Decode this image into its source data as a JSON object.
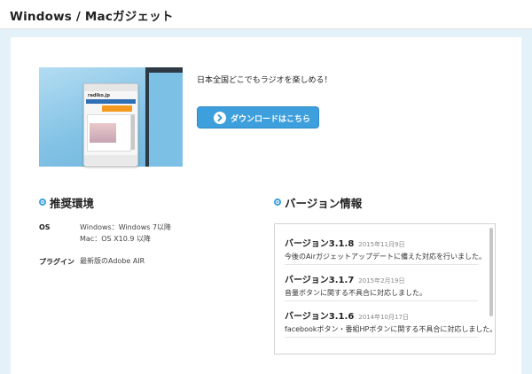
{
  "header": {
    "title": "Windows / Macガジェット"
  },
  "hero": {
    "phone_logo": "radiko.jp",
    "tagline": "日本全国どこでもラジオを楽しめる！",
    "download_label": "ダウンロードはこちら"
  },
  "requirements": {
    "title": "推奨環境",
    "rows": [
      {
        "label": "OS",
        "values": [
          "Windows：Windows 7以降",
          "Mac：OS X10.9 以降"
        ]
      },
      {
        "label": "プラグイン",
        "values": [
          "最新版のAdobe AIR"
        ]
      }
    ]
  },
  "versions": {
    "title": "バージョン情報",
    "items": [
      {
        "version": "バージョン3.1.8",
        "date": "2015年11月9日",
        "desc": "今後のAirガジェットアップデートに備えた対応を行いました。"
      },
      {
        "version": "バージョン3.1.7",
        "date": "2015年2月19日",
        "desc": "音量ボタンに関する不具合に対応しました。"
      },
      {
        "version": "バージョン3.1.6",
        "date": "2014年10月17日",
        "desc": "facebookボタン・番組HPボタンに関する不具合に対応しました。"
      }
    ]
  },
  "colors": {
    "accent": "#3d9fdb",
    "page_bg": "#e3f1f8"
  }
}
